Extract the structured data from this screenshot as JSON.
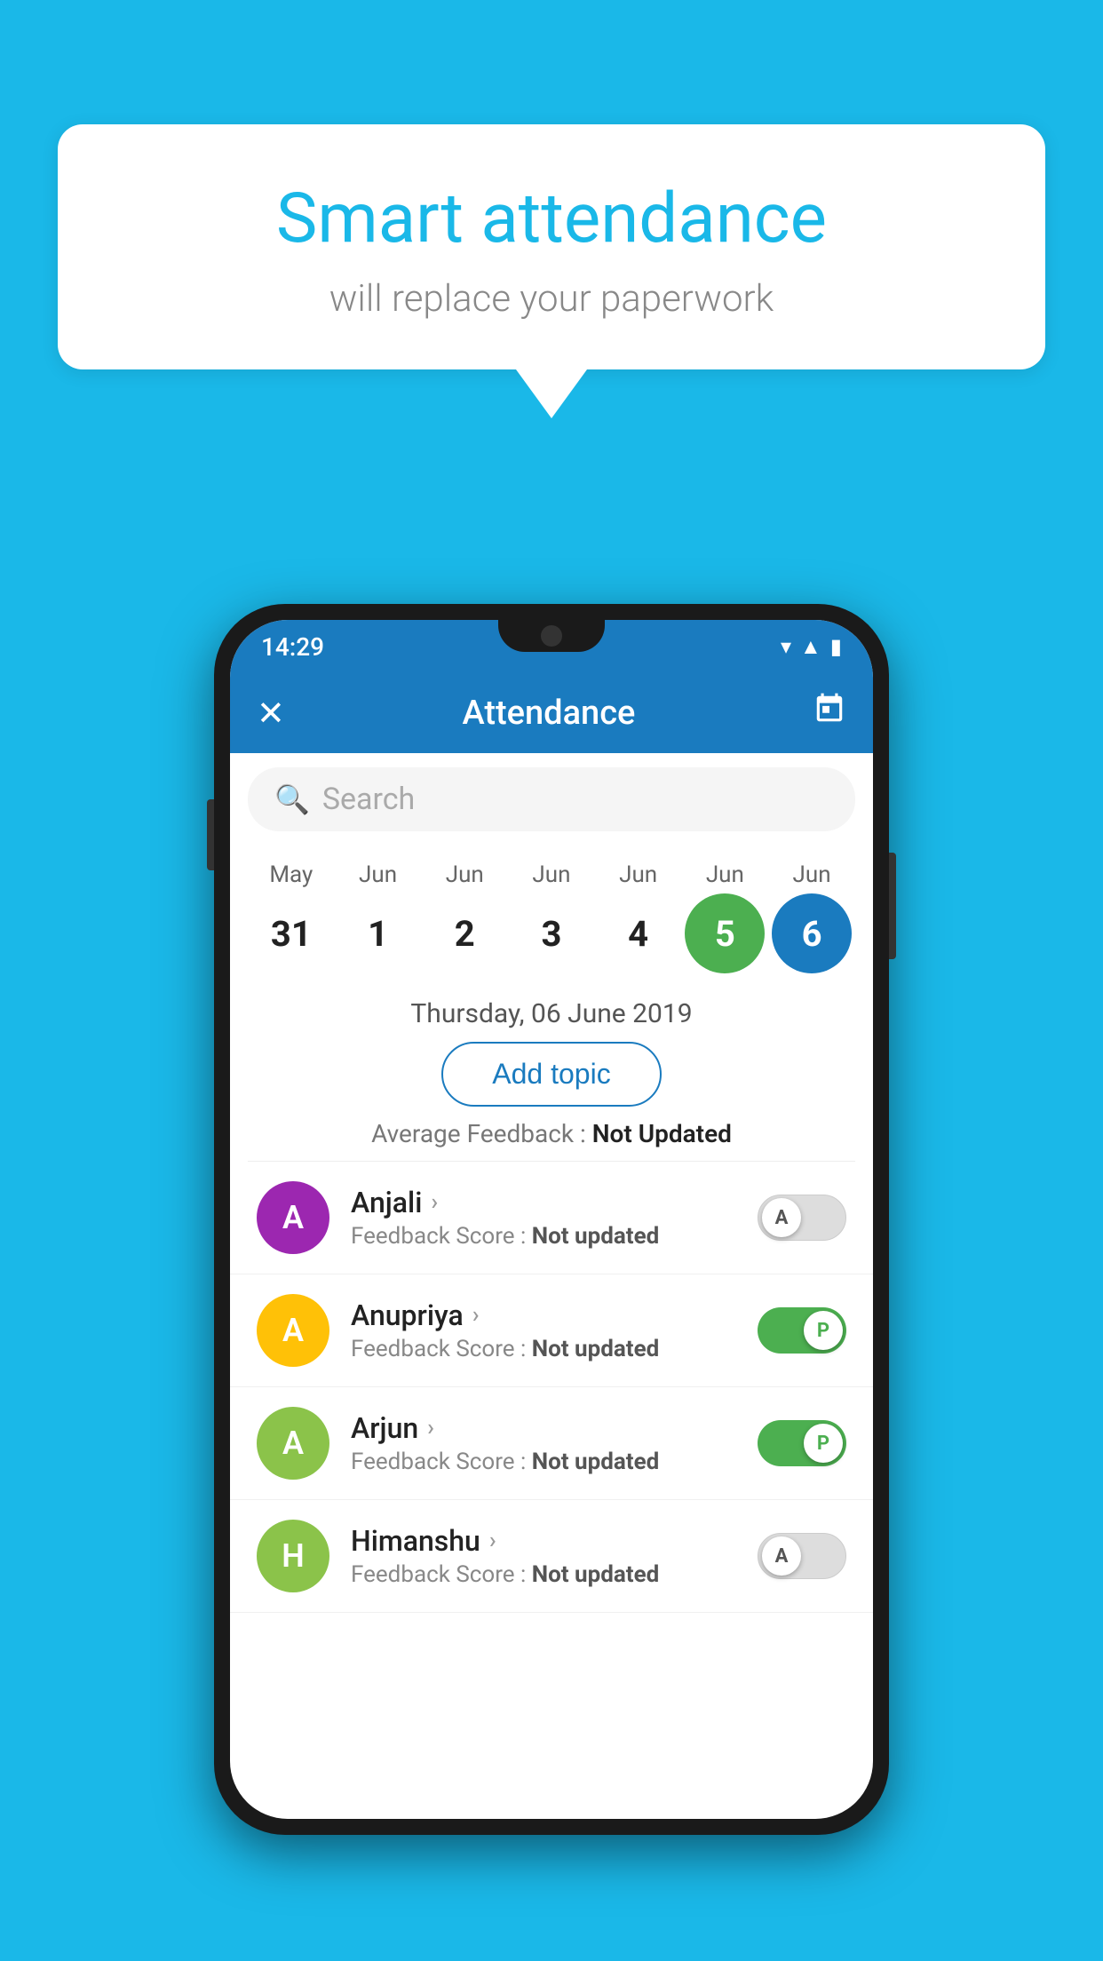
{
  "app": {
    "background_color": "#1ab8e8"
  },
  "bubble": {
    "title": "Smart attendance",
    "subtitle": "will replace your paperwork"
  },
  "status_bar": {
    "time": "14:29",
    "icons": [
      "wifi",
      "signal",
      "battery"
    ]
  },
  "app_bar": {
    "close_icon": "✕",
    "title": "Attendance",
    "calendar_icon": "📅"
  },
  "search": {
    "placeholder": "Search"
  },
  "calendar": {
    "months": [
      "May",
      "Jun",
      "Jun",
      "Jun",
      "Jun",
      "Jun",
      "Jun"
    ],
    "dates": [
      "31",
      "1",
      "2",
      "3",
      "4",
      "5",
      "6"
    ],
    "today_index": 5,
    "selected_index": 6
  },
  "selected_date_label": "Thursday, 06 June 2019",
  "add_topic_label": "Add topic",
  "average_feedback": {
    "label": "Average Feedback : ",
    "value": "Not Updated"
  },
  "students": [
    {
      "name": "Anjali",
      "avatar_letter": "A",
      "avatar_color": "#9c27b0",
      "feedback": "Not updated",
      "toggle_state": "off",
      "toggle_label": "A"
    },
    {
      "name": "Anupriya",
      "avatar_letter": "A",
      "avatar_color": "#ffc107",
      "feedback": "Not updated",
      "toggle_state": "on",
      "toggle_label": "P"
    },
    {
      "name": "Arjun",
      "avatar_letter": "A",
      "avatar_color": "#8bc34a",
      "feedback": "Not updated",
      "toggle_state": "on",
      "toggle_label": "P"
    },
    {
      "name": "Himanshu",
      "avatar_letter": "H",
      "avatar_color": "#8bc34a",
      "feedback": "Not updated",
      "toggle_state": "off",
      "toggle_label": "A"
    }
  ]
}
